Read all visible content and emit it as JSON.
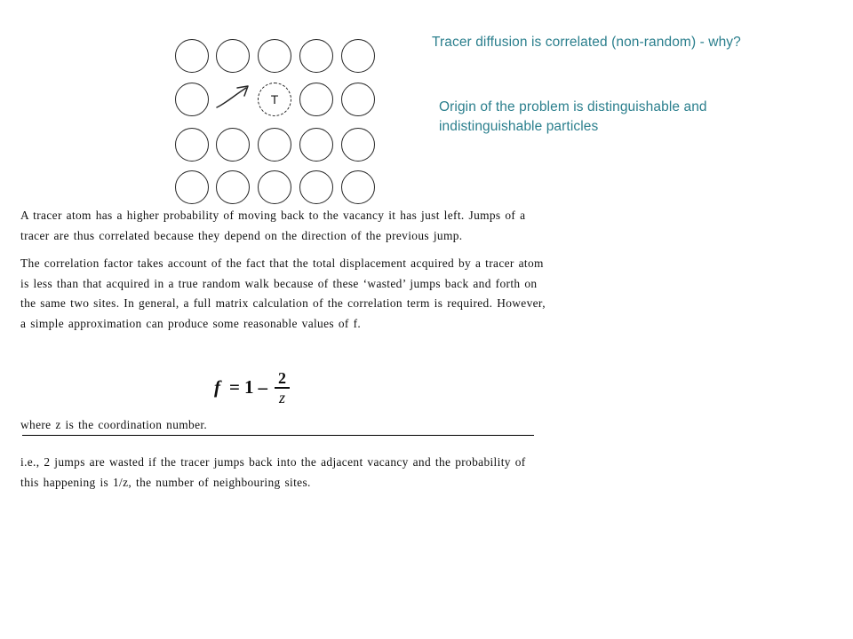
{
  "slide": {
    "title": "Tracer diffusion is correlated (non-random) - why?",
    "subtitle": "Origin of the problem is distinguishable and indistinguishable particles",
    "accent_color": "#2b7f8d"
  },
  "diagram": {
    "name": "lattice-vacancy-tracer-diagram",
    "rows": 4,
    "columns": 5,
    "tracer_label": "T",
    "tracer_position": {
      "row": 1,
      "column": 2
    },
    "vacancy_position": {
      "row": 1,
      "column": 1
    },
    "arrow": "jump-arrow-up-right",
    "cells": [
      [
        "atom",
        "atom",
        "atom",
        "atom",
        "atom"
      ],
      [
        "atom",
        "vacancy",
        "tracer",
        "atom",
        "atom"
      ],
      [
        "atom",
        "atom",
        "atom",
        "atom",
        "atom"
      ],
      [
        "atom",
        "atom",
        "atom",
        "atom",
        "atom"
      ]
    ]
  },
  "body": {
    "paragraph_1": "A tracer atom has a higher probability of moving back to the vacancy it has just left. Jumps of a tracer are thus correlated because they depend on the direction of the previous jump.",
    "paragraph_2": "The correlation factor takes account of the fact that the total displacement acquired by a tracer atom is less than that acquired in a true random walk because of these ‘wasted’ jumps back and forth on the same two sites. In general, a full matrix calculation of the correlation term is required. However, a simple approximation can produce some reasonable values of f."
  },
  "equation": {
    "lhs": "f",
    "operator_equals": "=",
    "one": "1",
    "operator_minus": "–",
    "numerator": "2",
    "denominator": "z",
    "plain": "f = 1 – 2/z"
  },
  "coordination_note": "where z is the coordination number.",
  "closing_text": "i.e., 2 jumps are wasted if the tracer jumps back into the adjacent vacancy and the probability of this happening is 1/z, the number of neighbouring sites."
}
